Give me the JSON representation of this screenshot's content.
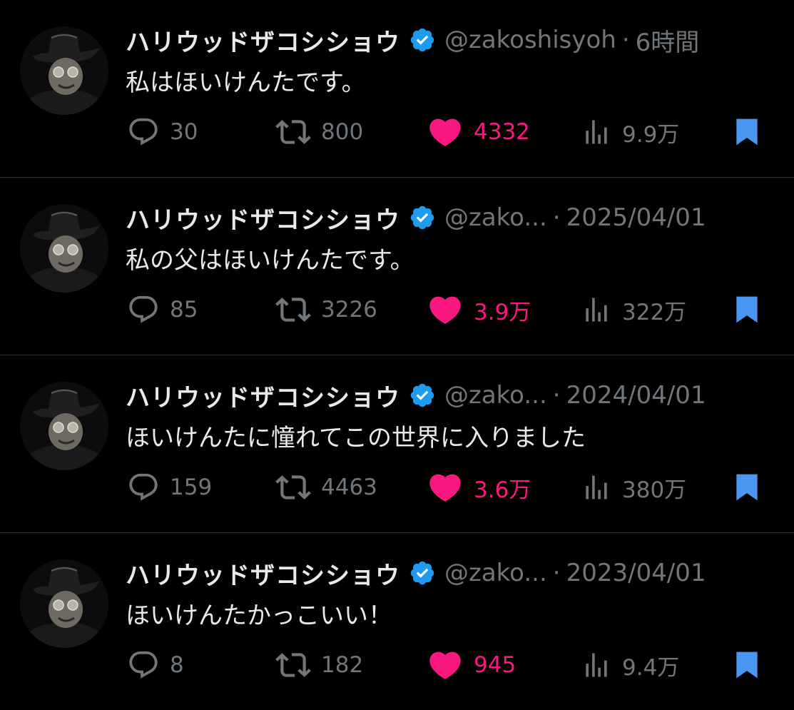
{
  "colors": {
    "background": "#000000",
    "text_primary": "#e7e9ea",
    "text_secondary": "#71767b",
    "like": "#f91880",
    "verified": "#1d9bf0",
    "bookmark": "#4a96f0"
  },
  "icons": [
    "reply-icon",
    "retweet-icon",
    "like-icon",
    "views-icon",
    "bookmark-icon",
    "verified-badge-icon"
  ],
  "tweets": [
    {
      "name": "ハリウッドザコシショウ",
      "handle": "@zakoshisyoh",
      "separator": "·",
      "time": "6時間",
      "text": "私はほいけんたです。",
      "replies": "30",
      "retweets": "800",
      "likes": "4332",
      "views": "9.9万"
    },
    {
      "name": "ハリウッドザコシショウ",
      "handle": "@zako...",
      "separator": "·",
      "time": "2025/04/01",
      "text": "私の父はほいけんたです。",
      "replies": "85",
      "retweets": "3226",
      "likes": "3.9万",
      "views": "322万"
    },
    {
      "name": "ハリウッドザコシショウ",
      "handle": "@zako...",
      "separator": "·",
      "time": "2024/04/01",
      "text": "ほいけんたに憧れてこの世界に入りました",
      "replies": "159",
      "retweets": "4463",
      "likes": "3.6万",
      "views": "380万"
    },
    {
      "name": "ハリウッドザコシショウ",
      "handle": "@zako...",
      "separator": "·",
      "time": "2023/04/01",
      "text": "ほいけんたかっこいい！",
      "replies": "8",
      "retweets": "182",
      "likes": "945",
      "views": "9.4万"
    }
  ]
}
